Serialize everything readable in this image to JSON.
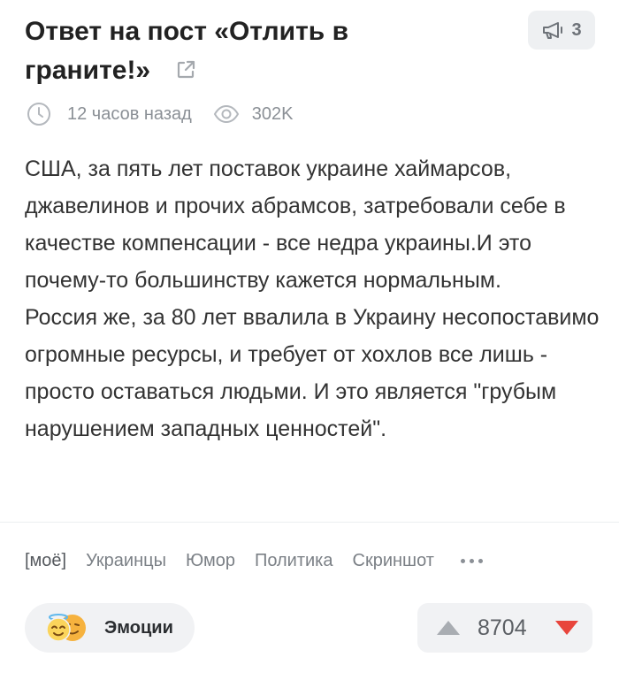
{
  "post": {
    "title_line1": "Ответ на пост «Отлить в",
    "title_line2": "граните!»",
    "comments_count": "3",
    "time_ago": "12 часов назад",
    "views": "302K",
    "body": [
      "США, за пять лет поставок украине хаймарсов, джавелинов и прочих абрамсов, затребовали себе в качестве компенсации - все недра украины.И это почему-то большинству кажется нормальным.",
      "Россия же, за 80 лет ввалила в Украину несопоставимо огромные ресурсы, и требует от хохлов все лишь - просто оставаться людьми. И это является \"грубым нарушением западных ценностей\"."
    ]
  },
  "tags": {
    "items": [
      "[моё]",
      "Украинцы",
      "Юмор",
      "Политика",
      "Скриншот"
    ]
  },
  "footer": {
    "emotions_label": "Эмоции",
    "rating": "8704"
  },
  "colors": {
    "vote_up": "#a9adb2",
    "vote_down": "#e8453c",
    "badge_bg": "#eef0f2",
    "muted_text": "#8b9096"
  },
  "icons": [
    "megaphone-icon",
    "external-link-icon",
    "clock-icon",
    "eye-icon",
    "more-dots-icon",
    "emoji-angel-icon",
    "emoji-smirk-icon",
    "arrow-up-icon",
    "arrow-down-icon"
  ]
}
